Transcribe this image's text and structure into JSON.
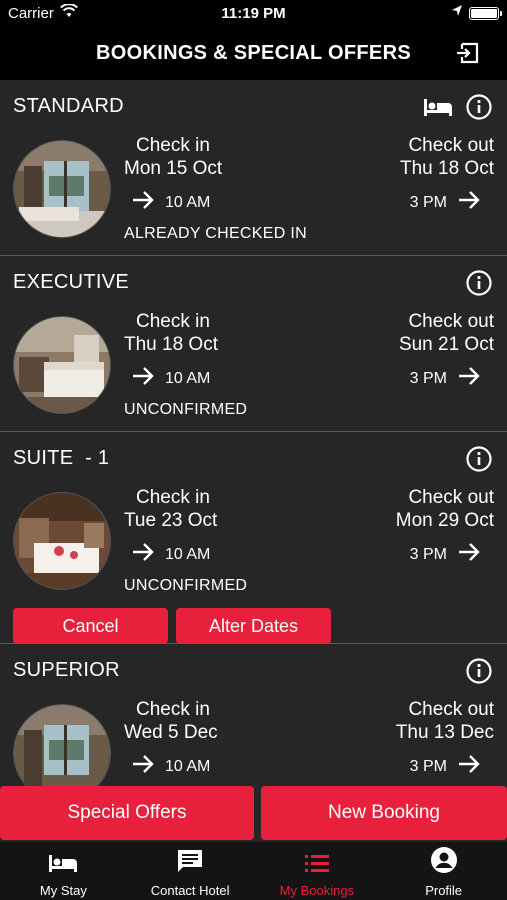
{
  "status_bar": {
    "carrier": "Carrier",
    "time": "11:19 PM"
  },
  "header": {
    "title": "BOOKINGS & SPECIAL OFFERS",
    "logout_icon": "logout-icon"
  },
  "bookings": [
    {
      "room": "STANDARD",
      "checkin_label": "Check in",
      "checkin_date": "Mon 15 Oct",
      "checkin_time": "10 AM",
      "checkout_label": "Check out",
      "checkout_date": "Thu 18 Oct",
      "checkout_time": "3 PM",
      "status": "ALREADY CHECKED IN"
    },
    {
      "room": "EXECUTIVE",
      "checkin_label": "Check in",
      "checkin_date": "Thu 18 Oct",
      "checkin_time": "10 AM",
      "checkout_label": "Check out",
      "checkout_date": "Sun 21 Oct",
      "checkout_time": "3 PM",
      "status": "UNCONFIRMED"
    },
    {
      "room": "SUITE  - 1",
      "checkin_label": "Check in",
      "checkin_date": "Tue 23 Oct",
      "checkin_time": "10 AM",
      "checkout_label": "Check out",
      "checkout_date": "Mon 29 Oct",
      "checkout_time": "3 PM",
      "status": "UNCONFIRMED",
      "cancel_label": "Cancel",
      "alter_label": "Alter Dates"
    },
    {
      "room": "SUPERIOR",
      "checkin_label": "Check in",
      "checkin_date": "Wed 5 Dec",
      "checkin_time": "10 AM",
      "checkout_label": "Check out",
      "checkout_date": "Thu 13 Dec",
      "checkout_time": "3 PM"
    }
  ],
  "bottom_buttons": {
    "special_offers": "Special Offers",
    "new_booking": "New Booking"
  },
  "tabs": [
    {
      "label": "My Stay",
      "icon": "bed-icon"
    },
    {
      "label": "Contact Hotel",
      "icon": "chat-icon"
    },
    {
      "label": "My Bookings",
      "icon": "list-icon",
      "active": true
    },
    {
      "label": "Profile",
      "icon": "account-icon"
    }
  ],
  "colors": {
    "accent": "#e8203c",
    "background": "#262626",
    "bar": "#000000"
  }
}
